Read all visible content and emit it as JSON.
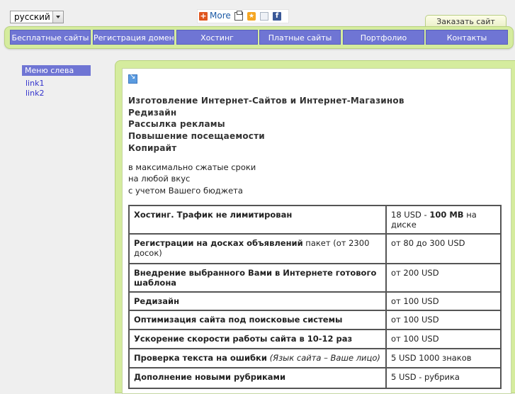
{
  "language": {
    "selected": "русский"
  },
  "share": {
    "more_label": "More",
    "plus_glyph": "+"
  },
  "order_button": "Заказать сайт",
  "nav": [
    "Бесплатные сайты",
    "Регистрация доменов",
    "Хостинг",
    "Платные сайты",
    "Портфолио",
    "Контакты"
  ],
  "left_menu": {
    "title": "Меню слева",
    "links": [
      "link1",
      "link2"
    ]
  },
  "headings": [
    "Изготовление Интернет-Сайтов и Интернет-Магазинов",
    "Редизайн",
    "Рассылка рекламы",
    "Повышение посещаемости",
    "Копирайт"
  ],
  "taglines": [
    "в максимально сжатые сроки",
    "на любой вкус",
    "с учетом Вашего бюджета"
  ],
  "prices": [
    {
      "service_bold": "Хостинг. Трафик не лимитирован",
      "service_rest": "",
      "service_italic": "",
      "price_pre": "18 USD - ",
      "price_bold": "100 MB",
      "price_post": " на диске"
    },
    {
      "service_bold": "Регистрации на досках объявлений",
      "service_rest": " пакет (от 2300 досок)",
      "service_italic": "",
      "price_pre": "от 80 до 300 USD",
      "price_bold": "",
      "price_post": ""
    },
    {
      "service_bold": "Внедрение выбранного Вами в Интернете готового шаблона",
      "service_rest": "",
      "service_italic": "",
      "price_pre": "от 200 USD",
      "price_bold": "",
      "price_post": ""
    },
    {
      "service_bold": "Редизайн",
      "service_rest": "",
      "service_italic": "",
      "price_pre": "от 100 USD",
      "price_bold": "",
      "price_post": ""
    },
    {
      "service_bold": "Оптимизация сайта под поисковые системы",
      "service_rest": "",
      "service_italic": "",
      "price_pre": "от 100 USD",
      "price_bold": "",
      "price_post": ""
    },
    {
      "service_bold": "Ускорение скорости работы сайта в 10-12 раз",
      "service_rest": "",
      "service_italic": "",
      "price_pre": "от 100 USD",
      "price_bold": "",
      "price_post": ""
    },
    {
      "service_bold": "Проверка текста на ошибки",
      "service_rest": " ",
      "service_italic": "(Язык сайта – Ваше лицо)",
      "price_pre": "5 USD 1000 знаков",
      "price_bold": "",
      "price_post": ""
    },
    {
      "service_bold": "Дополнение новыми рубриками",
      "service_rest": "",
      "service_italic": "",
      "price_pre": "5 USD - рубрика",
      "price_bold": "",
      "price_post": ""
    }
  ],
  "colors": {
    "nav_item_bg": "#6f75d4",
    "nav_bar_bg": "#d5ec9e",
    "link": "#3333cc"
  }
}
